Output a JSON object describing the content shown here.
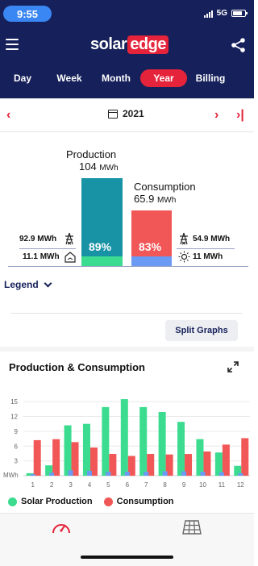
{
  "status": {
    "time": "9:55",
    "network": "5G"
  },
  "header": {
    "logo_solar": "solar",
    "logo_edge": "edge"
  },
  "periods": [
    {
      "label": "Day"
    },
    {
      "label": "Week"
    },
    {
      "label": "Month"
    },
    {
      "label": "Year",
      "active": true
    },
    {
      "label": "Billing"
    }
  ],
  "date": {
    "label": "2021"
  },
  "overview": {
    "production_title": "Production",
    "production_value": "104",
    "production_unit": "MWh",
    "production_self_pct": "89%",
    "consumption_title": "Consumption",
    "consumption_value": "65.9",
    "consumption_unit": "MWh",
    "consumption_self_pct": "83%",
    "export_value": "92.9 MWh",
    "self_consumed_value": "11.1 MWh",
    "import_value": "54.9 MWh",
    "from_solar_value": "11 MWh"
  },
  "legend_toggle": "Legend",
  "split_graphs_label": "Split Graphs",
  "chart_title": "Production & Consumption",
  "chart_data": {
    "type": "bar",
    "categories": [
      "1",
      "2",
      "3",
      "4",
      "5",
      "6",
      "7",
      "8",
      "9",
      "10",
      "11",
      "12"
    ],
    "ylabel": "MWh",
    "yticks": [
      "3",
      "6",
      "9",
      "12",
      "15"
    ],
    "ylim": [
      0,
      16
    ],
    "grid": true,
    "legend_position": "bottom",
    "series": [
      {
        "name": "Solar Production",
        "color": "#3bdc8f",
        "values": [
          0.5,
          2.1,
          10.2,
          10.5,
          13.9,
          15.5,
          13.9,
          12.9,
          10.9,
          7.4,
          4.7,
          2.0
        ]
      },
      {
        "name": "Consumption",
        "color": "#f25757",
        "values": [
          7.2,
          7.4,
          6.8,
          5.7,
          4.4,
          4.0,
          4.4,
          4.3,
          4.4,
          4.9,
          6.3,
          7.6
        ]
      },
      {
        "color": "#6b9af5",
        "values": [
          0.3,
          0.6,
          1.1,
          1.0,
          0.8,
          0.8,
          0.8,
          0.9,
          0.9,
          0.8,
          0.7,
          0.5
        ]
      }
    ]
  },
  "colors": {
    "header": "#16205a",
    "accent": "#e5243b",
    "production": "#1892a5",
    "self": "#3bdc8f",
    "consumption": "#f25757",
    "solar_used": "#6b9af5"
  },
  "bottom_nav": [
    {
      "icon": "dashboard-gauge-icon"
    },
    {
      "icon": "solar-panel-layout-icon"
    }
  ]
}
